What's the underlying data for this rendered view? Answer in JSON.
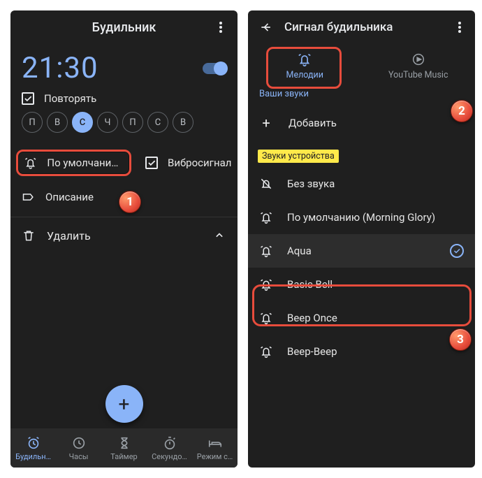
{
  "left": {
    "title": "Будильник",
    "time": "21:30",
    "repeat_label": "Повторять",
    "days": [
      "П",
      "В",
      "С",
      "Ч",
      "П",
      "С",
      "В"
    ],
    "selected_day_index": 2,
    "sound_label": "По умолчанию (",
    "vibrate_label": "Вибросигнал",
    "desc_label": "Описание",
    "delete_label": "Удалить",
    "nav": [
      {
        "label": "Будильн…",
        "active": true
      },
      {
        "label": "Часы",
        "active": false
      },
      {
        "label": "Таймер",
        "active": false
      },
      {
        "label": "Секундо…",
        "active": false
      },
      {
        "label": "Режим с…",
        "active": false
      }
    ]
  },
  "right": {
    "title": "Сигнал будильника",
    "tabs": {
      "melodies": "Мелодии",
      "ytmusic": "YouTube Music"
    },
    "your_sounds": "Ваши звуки",
    "add_label": "Добавить",
    "device_sounds": "Звуки устройства",
    "sounds": [
      {
        "name": "Без звука",
        "icon": "mute"
      },
      {
        "name": "По умолчанию (Morning Glory)",
        "icon": "bell"
      },
      {
        "name": "Aqua",
        "icon": "bell",
        "selected": true
      },
      {
        "name": "Basic Bell",
        "icon": "bell"
      },
      {
        "name": "Beep Once",
        "icon": "bell"
      },
      {
        "name": "Beep-Beep",
        "icon": "bell"
      }
    ]
  },
  "callouts": {
    "c1": "1",
    "c2": "2",
    "c3": "3"
  }
}
